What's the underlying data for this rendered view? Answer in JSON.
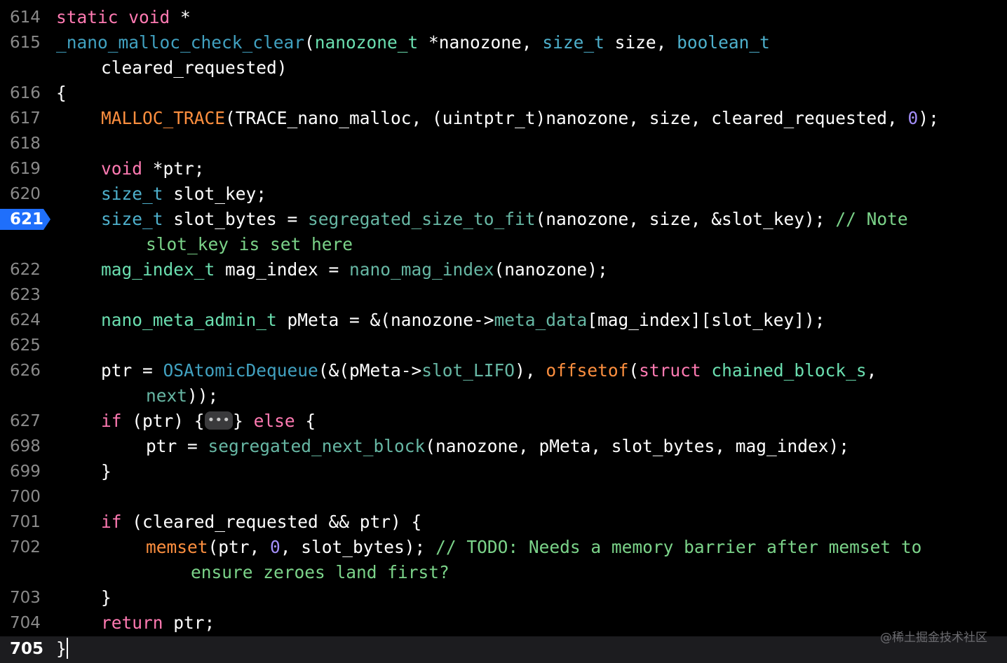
{
  "editor": {
    "line_numbers": [
      "614",
      "615",
      "616",
      "617",
      "618",
      "619",
      "620",
      "621",
      "622",
      "623",
      "624",
      "625",
      "626",
      "627",
      "698",
      "699",
      "700",
      "701",
      "702",
      "703",
      "704",
      "705"
    ],
    "current_line": "705",
    "breakpoint_line": "621"
  },
  "code": {
    "l614": {
      "kw1": "static",
      "kw2": "void",
      "rest": " *"
    },
    "l615": {
      "fn": "_nano_malloc_check_clear",
      "p1": "(",
      "t1": "nanozone_t",
      "p2": " *nanozone, ",
      "t2": "size_t",
      "p3": " size, ",
      "t3": "boolean_t"
    },
    "l615b": {
      "text": "cleared_requested)"
    },
    "l616": {
      "text": "{"
    },
    "l617": {
      "macro": "MALLOC_TRACE",
      "p1": "(TRACE_nano_malloc, (uintptr_t)nanozone, size, cleared_requested, ",
      "num": "0",
      "p2": ");"
    },
    "l619": {
      "kw": "void",
      "rest": " *ptr;"
    },
    "l620": {
      "typ": "size_t",
      "rest": " slot_key;"
    },
    "l621": {
      "typ": "size_t",
      "p1": " slot_bytes = ",
      "fn": "segregated_size_to_fit",
      "p2": "(nanozone, size, &slot_key); ",
      "cm": "// Note"
    },
    "l621b": {
      "cm": "slot_key is set here"
    },
    "l622": {
      "typ": "mag_index_t",
      "p1": " mag_index = ",
      "fn": "nano_mag_index",
      "p2": "(nanozone);"
    },
    "l624": {
      "typ": "nano_meta_admin_t",
      "p1": " pMeta = &(nanozone->",
      "field": "meta_data",
      "p2": "[mag_index][slot_key]);"
    },
    "l626": {
      "p1": "ptr = ",
      "fn": "OSAtomicDequeue",
      "p2": "(&(pMeta->",
      "field": "slot_LIFO",
      "p3": "), ",
      "macro": "offsetof",
      "p4": "(",
      "kw": "struct",
      "p5": " ",
      "typ": "chained_block_s",
      "p6": ","
    },
    "l626b": {
      "field": "next",
      "p1": "));"
    },
    "l627": {
      "kw1": "if",
      "p1": " (ptr) {",
      "fold": "•••",
      "p2": "} ",
      "kw2": "else",
      "p3": " {"
    },
    "l698": {
      "p1": "ptr = ",
      "fn": "segregated_next_block",
      "p2": "(nanozone, pMeta, slot_bytes, mag_index);"
    },
    "l699": {
      "text": "}"
    },
    "l701": {
      "kw": "if",
      "p1": " (cleared_requested && ptr) {"
    },
    "l702": {
      "macro": "memset",
      "p1": "(ptr, ",
      "num": "0",
      "p2": ", slot_bytes); ",
      "cm": "// TODO: Needs a memory barrier after memset to"
    },
    "l702b": {
      "cm": "ensure zeroes land first?"
    },
    "l703": {
      "text": "}"
    },
    "l704": {
      "kw": "return",
      "rest": " ptr;"
    },
    "l705": {
      "text": "}"
    }
  },
  "watermark": "@稀土掘金技术社区",
  "colors": {
    "background": "#000000",
    "keyword": "#ff7ab2",
    "type": "#4eb0cc",
    "function_green": "#67b7a4",
    "macro": "#fd8f3f",
    "number": "#a48ff9",
    "comment": "#7bd389",
    "breakpoint": "#1f6ffb"
  }
}
